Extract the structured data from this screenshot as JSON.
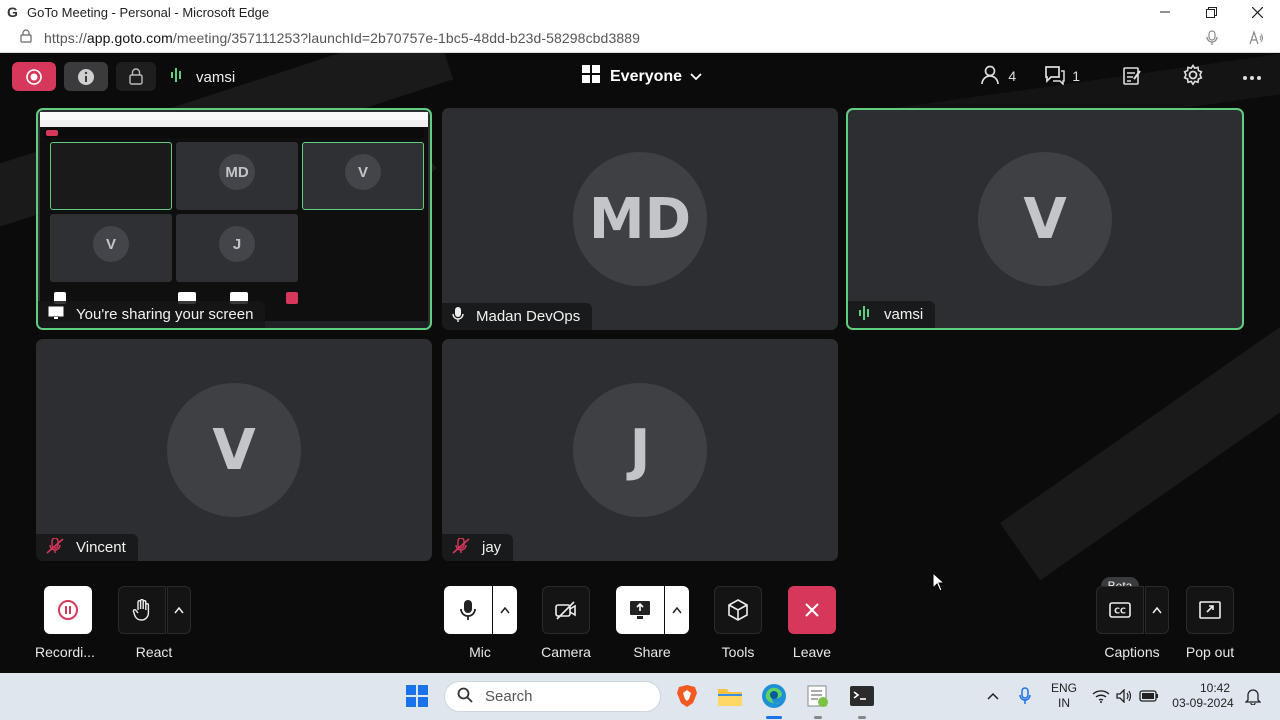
{
  "browser": {
    "window_title": "GoTo Meeting - Personal - Microsoft Edge",
    "url_prefix": "https://",
    "url_host": "app.goto.com",
    "url_path": "/meeting/357111253?launchId=2b70757e-1bc5-48dd-b23d-58298cbd3889"
  },
  "topbar": {
    "active_speaker": "vamsi",
    "view_label": "Everyone",
    "participants_count": "4",
    "chat_count": "1"
  },
  "tiles": [
    {
      "label": "You're sharing your screen",
      "initials": ""
    },
    {
      "label": "Madan DevOps",
      "initials": "MD"
    },
    {
      "label": "vamsi",
      "initials": "V"
    },
    {
      "label": "Vincent",
      "initials": "V"
    },
    {
      "label": "jay",
      "initials": "J"
    }
  ],
  "share_preview": {
    "tile_initials": [
      "MD",
      "V",
      "V",
      "J"
    ]
  },
  "controls": {
    "recording": "Recordi...",
    "react": "React",
    "mic": "Mic",
    "camera": "Camera",
    "share": "Share",
    "tools": "Tools",
    "leave": "Leave",
    "captions": "Captions",
    "captions_badge": "Beta",
    "popout": "Pop out"
  },
  "taskbar": {
    "search_placeholder": "Search",
    "lang_line1": "ENG",
    "lang_line2": "IN",
    "time": "10:42",
    "date": "03-09-2024"
  },
  "colors": {
    "accent_red": "#d6385b",
    "active_green": "#5fcf7f",
    "tile_bg": "#2d2e31"
  }
}
